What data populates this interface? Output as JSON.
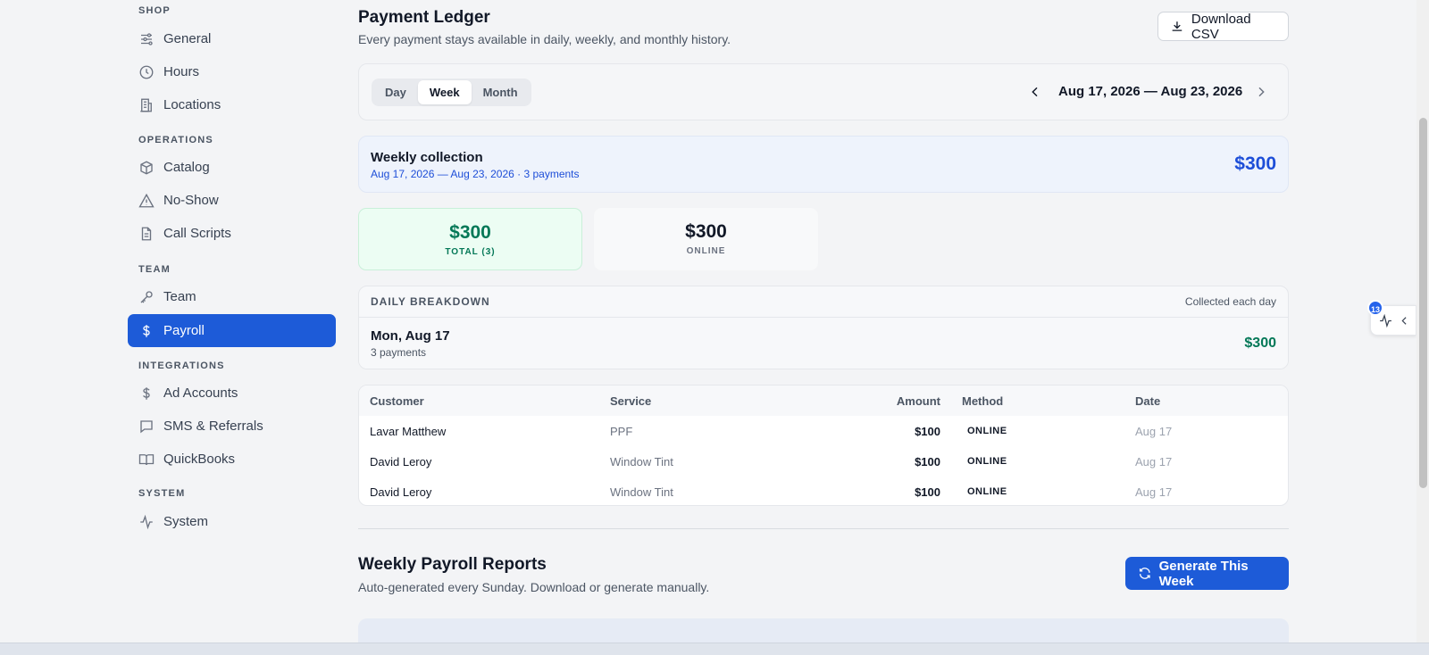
{
  "sidebar": {
    "sections": [
      {
        "title": "SHOP",
        "items": [
          "General",
          "Hours",
          "Locations"
        ]
      },
      {
        "title": "OPERATIONS",
        "items": [
          "Catalog",
          "No-Show",
          "Call Scripts"
        ]
      },
      {
        "title": "TEAM",
        "items": [
          "Team",
          "Payroll"
        ]
      },
      {
        "title": "INTEGRATIONS",
        "items": [
          "Ad Accounts",
          "SMS & Referrals",
          "QuickBooks"
        ]
      },
      {
        "title": "SYSTEM",
        "items": [
          "System"
        ]
      }
    ],
    "active": "Payroll"
  },
  "ledger": {
    "title": "Payment Ledger",
    "subtitle": "Every payment stays available in daily, weekly, and monthly history.",
    "download_label": "Download CSV",
    "tabs": [
      "Day",
      "Week",
      "Month"
    ],
    "active_tab": "Week",
    "range": "Aug 17, 2026 — Aug 23, 2026"
  },
  "weekly": {
    "title": "Weekly collection",
    "detail": "Aug 17, 2026 — Aug 23, 2026 · 3 payments",
    "amount": "$300"
  },
  "stats": [
    {
      "value": "$300",
      "label": "TOTAL (3)"
    },
    {
      "value": "$300",
      "label": "ONLINE"
    }
  ],
  "breakdown": {
    "title": "DAILY BREAKDOWN",
    "note": "Collected each day",
    "day": "Mon, Aug 17",
    "count": "3 payments",
    "amount": "$300"
  },
  "table": {
    "headers": [
      "Customer",
      "Service",
      "Amount",
      "Method",
      "Date"
    ],
    "rows": [
      [
        "Lavar Matthew",
        "PPF",
        "$100",
        "ONLINE",
        "Aug 17"
      ],
      [
        "David Leroy",
        "Window Tint",
        "$100",
        "ONLINE",
        "Aug 17"
      ],
      [
        "David Leroy",
        "Window Tint",
        "$100",
        "ONLINE",
        "Aug 17"
      ]
    ]
  },
  "reports": {
    "title": "Weekly Payroll Reports",
    "subtitle": "Auto-generated every Sunday. Download or generate manually.",
    "button": "Generate This Week"
  },
  "widget": {
    "badge": "13"
  },
  "colors": {
    "accent": "#1d5bd8",
    "green": "#047857",
    "blue_text": "#1d4ed8"
  }
}
